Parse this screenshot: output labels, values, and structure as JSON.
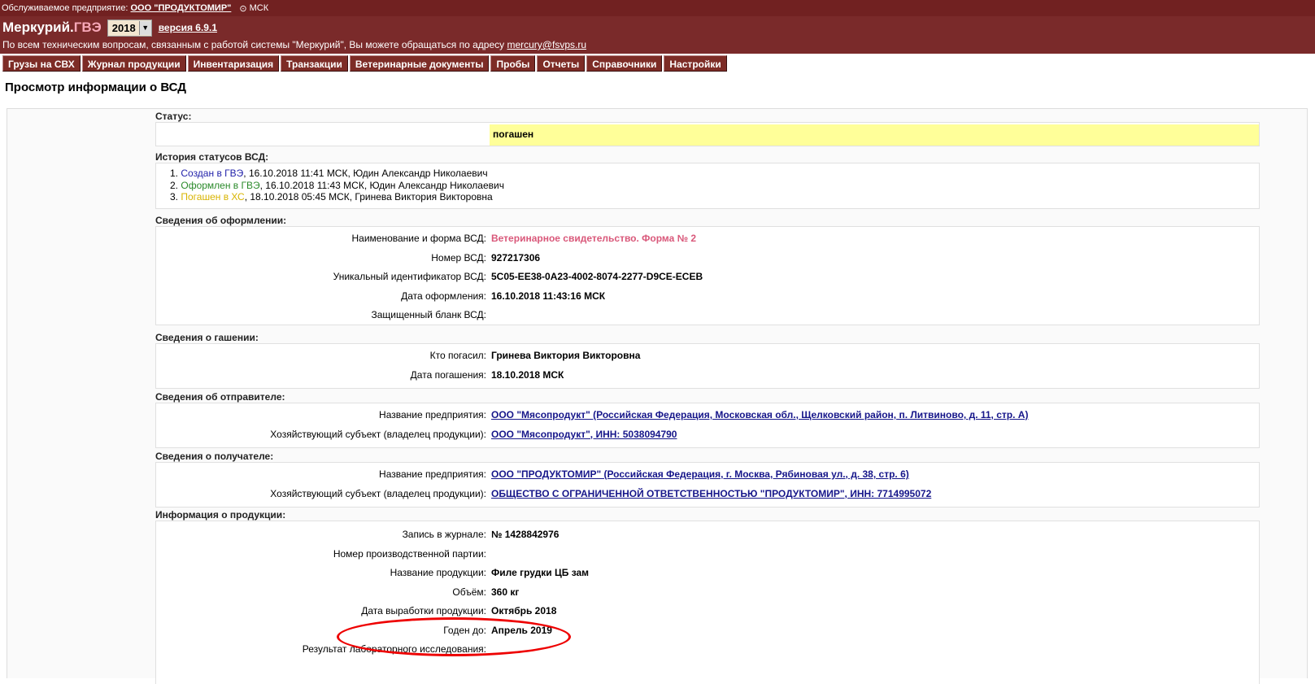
{
  "topbar": {
    "label": "Обслуживаемое предприятие:",
    "enterprise": "ООО \"ПРОДУКТОМИР\"",
    "clock_icon": "clock-icon",
    "timezone": "МСК"
  },
  "header": {
    "logo_main": "Меркурий.",
    "logo_sub": "ГВЭ",
    "year": "2018",
    "version": "версия 6.9.1",
    "support_text": "По всем техническим вопросам, связанным с работой системы \"Меркурий\", Вы можете обращаться по адресу",
    "support_email": "mercury@fsvps.ru"
  },
  "nav": [
    "Грузы на СВХ",
    "Журнал продукции",
    "Инвентаризация",
    "Транзакции",
    "Ветеринарные документы",
    "Пробы",
    "Отчеты",
    "Справочники",
    "Настройки"
  ],
  "page_title": "Просмотр информации о ВСД",
  "status": {
    "caption": "Статус:",
    "value": "погашен"
  },
  "history": {
    "caption": "История статусов ВСД:",
    "items": [
      {
        "n": "1.",
        "status": "Создан в ГВЭ",
        "rest": ", 16.10.2018 11:41 МСК, Юдин Александр Николаевич"
      },
      {
        "n": "2.",
        "status": "Оформлен в ГВЭ",
        "rest": ", 16.10.2018 11:43 МСК, Юдин Александр Николаевич"
      },
      {
        "n": "3.",
        "status": "Погашен в ХС",
        "rest": ", 18.10.2018 05:45 МСК, Гринева Виктория Викторовна"
      }
    ]
  },
  "registration": {
    "caption": "Сведения об оформлении:",
    "rows": [
      {
        "label": "Наименование и форма ВСД:",
        "value": "Ветеринарное свидетельство. Форма № 2"
      },
      {
        "label": "Номер ВСД:",
        "value": "927217306"
      },
      {
        "label": "Уникальный идентификатор ВСД:",
        "value": "5C05-EE38-0A23-4002-8074-2277-D9CE-ECEB"
      },
      {
        "label": "Дата оформления:",
        "value": "16.10.2018 11:43:16 МСК"
      },
      {
        "label": "Защищенный бланк ВСД:",
        "value": ""
      }
    ]
  },
  "redemption": {
    "caption": "Сведения о гашении:",
    "rows": [
      {
        "label": "Кто погасил:",
        "value": "Гринева Виктория Викторовна"
      },
      {
        "label": "Дата погашения:",
        "value": "18.10.2018 МСК"
      }
    ]
  },
  "sender": {
    "caption": "Сведения об отправителе:",
    "rows": [
      {
        "label": "Название предприятия:",
        "value": "ООО \"Мясопродукт\" (Российская Федерация, Московская обл., Щелковский район, п. Литвиново, д. 11, стр. А)"
      },
      {
        "label": "Хозяйствующий субъект (владелец продукции):",
        "value": "ООО \"Мясопродукт\", ИНН: 5038094790"
      }
    ]
  },
  "receiver": {
    "caption": "Сведения о получателе:",
    "rows": [
      {
        "label": "Название предприятия:",
        "value": "ООО \"ПРОДУКТОМИР\" (Российская Федерация, г. Москва, Рябиновая ул., д. 38, стр. 6)"
      },
      {
        "label": "Хозяйствующий субъект (владелец продукции):",
        "value": "ОБЩЕСТВО С ОГРАНИЧЕННОЙ ОТВЕТСТВЕННОСТЬЮ \"ПРОДУКТОМИР\", ИНН: 7714995072"
      }
    ]
  },
  "product": {
    "caption": "Информация о продукции:",
    "rows": [
      {
        "label": "Запись в журнале:",
        "value": "№ 1428842976"
      },
      {
        "label": "Номер производственной партии:",
        "value": ""
      },
      {
        "label": "Название продукции:",
        "value": "Филе грудки ЦБ зам"
      },
      {
        "label": "Объём:",
        "value": "360 кг"
      },
      {
        "label": "Дата выработки продукции:",
        "value": "Октябрь 2018"
      },
      {
        "label": "Годен до:",
        "value": "Апрель 2019"
      },
      {
        "label": "Результат лабораторного исследования:",
        "value": ""
      }
    ]
  },
  "colors": {
    "brand_dark": "#712121",
    "tab_bg": "#7d2c26",
    "status_highlight": "#ffff99",
    "link": "#16168a",
    "annotation": "#e00000"
  }
}
